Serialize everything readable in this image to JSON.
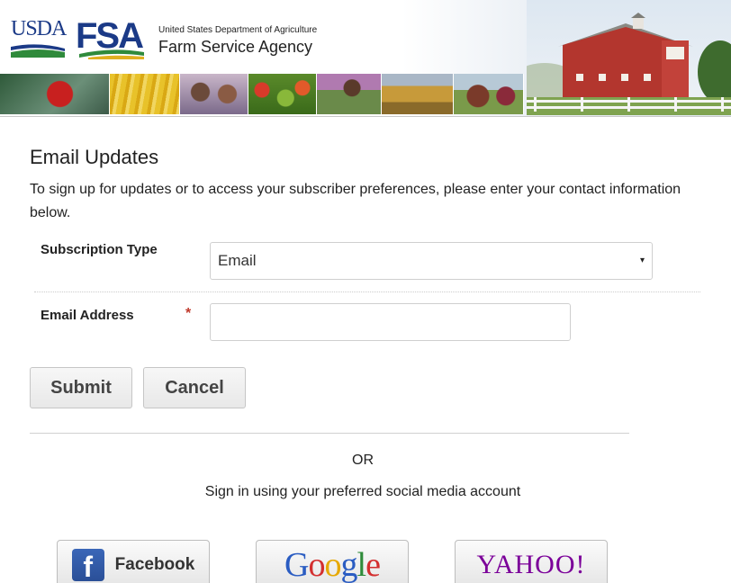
{
  "header": {
    "usda_logo_text": "USDA",
    "fsa_logo_text": "FSA",
    "department": "United States Department of Agriculture",
    "agency": "Farm Service Agency"
  },
  "form": {
    "title": "Email Updates",
    "intro": "To sign up for updates or to access your subscriber preferences, please enter your contact information below.",
    "subscription_type_label": "Subscription Type",
    "subscription_type_value": "Email",
    "email_label": "Email Address",
    "required_marker": "*",
    "email_value": "",
    "submit_label": "Submit",
    "cancel_label": "Cancel"
  },
  "social": {
    "or_text": "OR",
    "signin_text": "Sign in using your preferred social media account",
    "facebook_label": "Facebook",
    "facebook_icon_letter": "f",
    "google_letters": [
      "G",
      "o",
      "o",
      "g",
      "l",
      "e"
    ],
    "google_colors": [
      "#2a5cc2",
      "#d32f2f",
      "#e6a800",
      "#2a5cc2",
      "#2e8b3a",
      "#d32f2f"
    ],
    "yahoo_label": "YAHOO!"
  },
  "icons": {
    "select_arrow": "▾"
  }
}
